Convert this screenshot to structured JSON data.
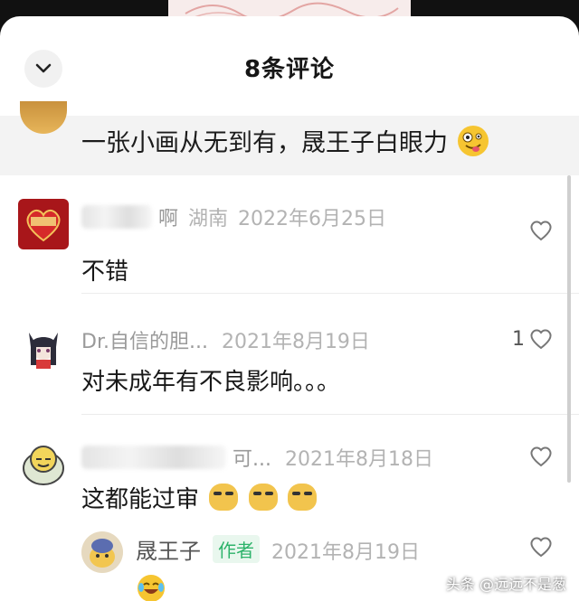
{
  "header": {
    "title": "8条评论",
    "collapse_icon": "chevron-down-icon"
  },
  "pinned_comment": {
    "text": "一张小画从无到有，晟王子白眼力",
    "emoji": "zany-face-emoji"
  },
  "comments": [
    {
      "user_visible": "啊",
      "location": "湖南",
      "date": "2022年6月25日",
      "text": "不错",
      "likes": ""
    },
    {
      "user_visible": "Dr.自信的胆...",
      "location": "",
      "date": "2021年8月19日",
      "text": "对未成年有不良影响。。。",
      "likes": "1"
    },
    {
      "user_visible": "可...",
      "location": "",
      "date": "2021年8月18日",
      "text": "这都能过审",
      "likes": ""
    }
  ],
  "reply": {
    "user": "晟王子",
    "badge": "作者",
    "date": "2021年8月19日",
    "emoji": "laughing-tears-emoji"
  },
  "colors": {
    "accent_green": "#2db36a",
    "meta_gray": "#b3b3b3"
  },
  "watermark": "头条 @远远不是葱"
}
